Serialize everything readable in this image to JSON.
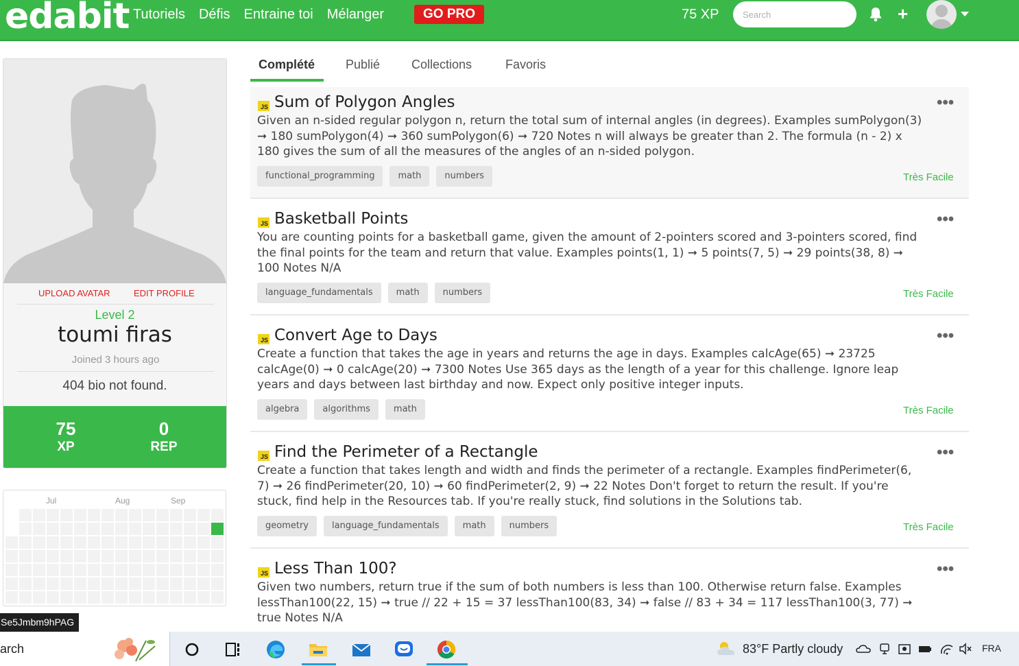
{
  "nav": {
    "logo": "edabit",
    "links": [
      "Tutoriels",
      "Défis",
      "Entraine toi",
      "Mélanger"
    ],
    "gopro": "GO PRO",
    "xp": "75 XP",
    "search_placeholder": "Search"
  },
  "profile": {
    "upload_avatar": "UPLOAD AVATAR",
    "edit_profile": "EDIT PROFILE",
    "level": "Level 2",
    "name": "toumi firas",
    "joined": "Joined 3 hours ago",
    "bio": "404 bio not found.",
    "xp_value": "75",
    "xp_label": "XP",
    "rep_value": "0",
    "rep_label": "REP"
  },
  "activity": {
    "months": [
      "Jul",
      "Aug",
      "Sep"
    ]
  },
  "tooltip": "Se5Jmbm9hPAG",
  "tabs": [
    "Complété",
    "Publié",
    "Collections",
    "Favoris"
  ],
  "challenges": [
    {
      "lang": "JS",
      "title": "Sum of Polygon Angles",
      "description": "Given an n-sided regular polygon n, return the total sum of internal angles (in degrees). Examples sumPolygon(3) ➞ 180 sumPolygon(4) ➞ 360 sumPolygon(6) ➞ 720 Notes n will always be greater than 2. The formula (n - 2) x 180 gives the sum of all the measures of the angles of an n-sided polygon.",
      "tags": [
        "functional_programming",
        "math",
        "numbers"
      ],
      "difficulty": "Très Facile"
    },
    {
      "lang": "JS",
      "title": "Basketball Points",
      "description": "You are counting points for a basketball game, given the amount of 2-pointers scored and 3-pointers scored, find the final points for the team and return that value. Examples points(1, 1) ➞ 5 points(7, 5) ➞ 29 points(38, 8) ➞ 100 Notes N/A",
      "tags": [
        "language_fundamentals",
        "math",
        "numbers"
      ],
      "difficulty": "Très Facile"
    },
    {
      "lang": "JS",
      "title": "Convert Age to Days",
      "description": "Create a function that takes the age in years and returns the age in days. Examples calcAge(65) ➞ 23725 calcAge(0) ➞ 0 calcAge(20) ➞ 7300 Notes Use 365 days as the length of a year for this challenge. Ignore leap years and days between last birthday and now. Expect only positive integer inputs.",
      "tags": [
        "algebra",
        "algorithms",
        "math"
      ],
      "difficulty": "Très Facile"
    },
    {
      "lang": "JS",
      "title": "Find the Perimeter of a Rectangle",
      "description": "Create a function that takes length and width and finds the perimeter of a rectangle. Examples findPerimeter(6, 7) ➞ 26 findPerimeter(20, 10) ➞ 60 findPerimeter(2, 9) ➞ 22 Notes Don't forget to return the result. If you're stuck, find help in the Resources tab. If you're really stuck, find solutions in the Solutions tab.",
      "tags": [
        "geometry",
        "language_fundamentals",
        "math",
        "numbers"
      ],
      "difficulty": "Très Facile"
    },
    {
      "lang": "JS",
      "title": "Less Than 100?",
      "description": "Given two numbers, return true if the sum of both numbers is less than 100. Otherwise return false. Examples lessThan100(22, 15) ➞ true // 22 + 15 = 37 lessThan100(83, 34) ➞ false // 83 + 34 = 117 lessThan100(3, 77) ➞ true Notes N/A",
      "tags": [],
      "difficulty": ""
    }
  ],
  "taskbar": {
    "search_text": "arch",
    "weather": "83°F  Partly cloudy",
    "language": "FRA"
  },
  "colors": {
    "brand_green": "#3bb84a",
    "pro_red": "#e01d1d",
    "js_yellow": "#f0d41a"
  }
}
